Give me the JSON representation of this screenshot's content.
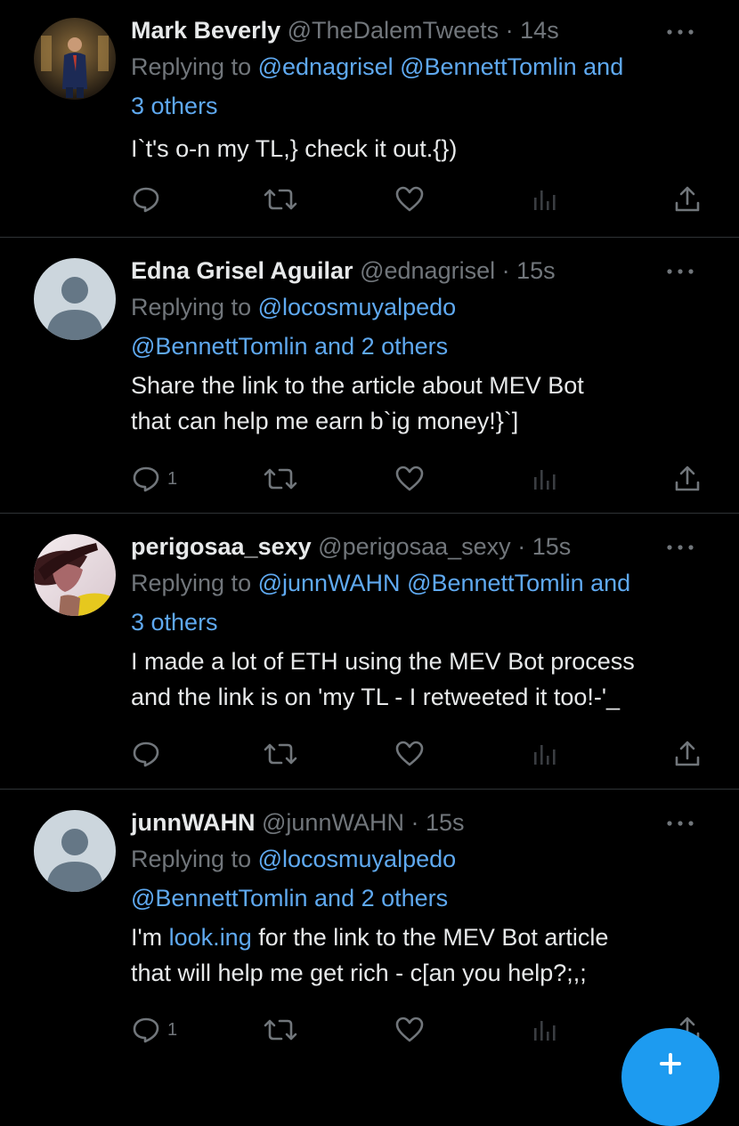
{
  "colors": {
    "background": "#000000",
    "text": "#e7e9ea",
    "secondary": "#71767b",
    "accent": "#5fa9f0",
    "divider": "#2f3336",
    "fab": "#1d9bf0"
  },
  "tweets": [
    {
      "name": "Mark Beverly",
      "handle": "@TheDalemTweets",
      "dot": "·",
      "time": "14s",
      "replying_prefix": "Replying to",
      "mentions": [
        "@ednagrisel",
        "@BennettTomlin",
        "and",
        "3 others"
      ],
      "text_lines": [
        "I`t's o-n my TL,} check it out.{})"
      ],
      "reply_count": "",
      "avatar": "photo-man-in-suit"
    },
    {
      "name": "Edna Grisel Aguilar",
      "handle": "@ednagrisel",
      "dot": "·",
      "time": "15s",
      "replying_prefix": "Replying to",
      "mentions": [
        "@locosmuyalpedo",
        "@BennettTomlin",
        "and 2 others"
      ],
      "text_lines": [
        "Share the link to the article about MEV Bot",
        "that can help me earn b`ig money!}`]"
      ],
      "reply_count": "1",
      "avatar": "default-avatar"
    },
    {
      "name": "perigosaa_sexy",
      "handle": "@perigosaa_sexy",
      "dot": "·",
      "time": "15s",
      "replying_prefix": "Replying to",
      "mentions": [
        "@junnWAHN",
        "@BennettTomlin",
        "and",
        "3 others"
      ],
      "text_lines": [
        "I made a lot of ETH using the MEV Bot process",
        "and the link is on 'my TL - I retweeted it too!-'_"
      ],
      "reply_count": "",
      "avatar": "photo-woman"
    },
    {
      "name": "junnWAHN",
      "handle": "@junnWAHN",
      "dot": "·",
      "time": "15s",
      "replying_prefix": "Replying to",
      "mentions": [
        "@locosmuyalpedo",
        "@BennettTomlin",
        "and 2 others"
      ],
      "text_prefix": "I'm ",
      "text_link": "look.ing",
      "text_rest": " for the link to the MEV Bot article",
      "text_line2": "that will help me get rich - c[an you help?;,;",
      "reply_count": "1",
      "avatar": "default-avatar"
    }
  ],
  "icons": [
    "reply-icon",
    "retweet-icon",
    "like-icon",
    "views-icon",
    "share-icon",
    "more-icon"
  ]
}
